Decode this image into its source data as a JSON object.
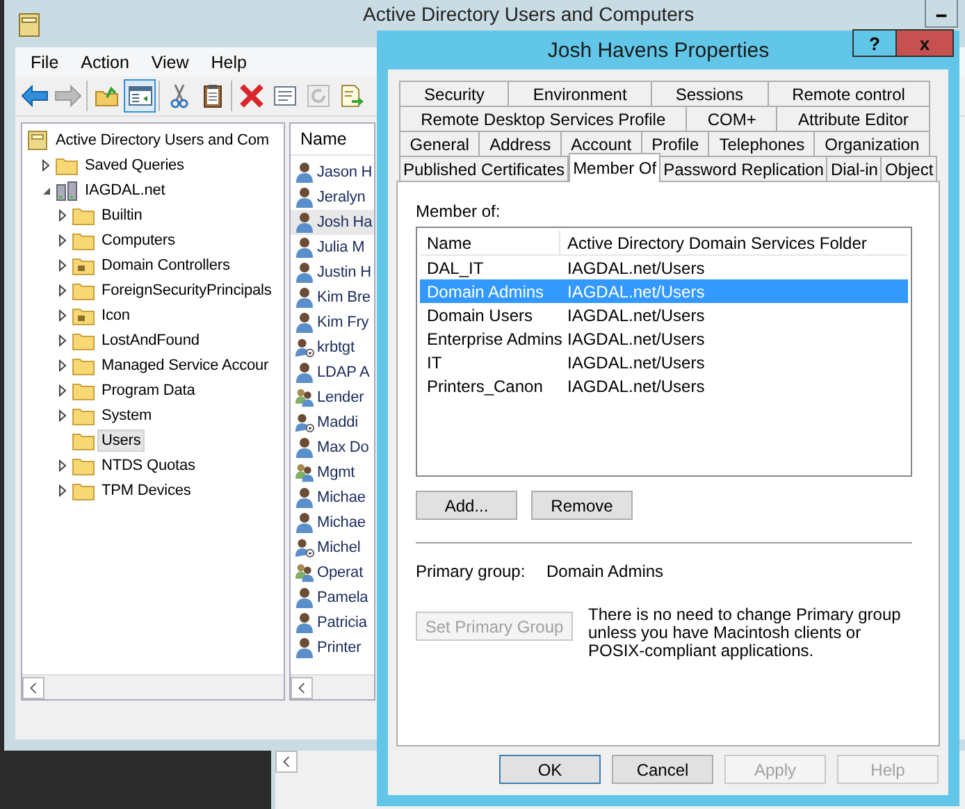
{
  "main_window": {
    "title": "Active Directory Users and Computers",
    "menu": [
      "File",
      "Action",
      "View",
      "Help"
    ],
    "toolbar": [
      {
        "kind": "back",
        "disabled": false,
        "selected": false
      },
      {
        "kind": "forward",
        "disabled": true,
        "selected": false
      },
      {
        "kind": "sep"
      },
      {
        "kind": "up",
        "disabled": false,
        "selected": false
      },
      {
        "kind": "tree",
        "disabled": false,
        "selected": true
      },
      {
        "kind": "sep"
      },
      {
        "kind": "cut",
        "disabled": false,
        "selected": false
      },
      {
        "kind": "paste",
        "disabled": false,
        "selected": false
      },
      {
        "kind": "sep"
      },
      {
        "kind": "delete",
        "disabled": false,
        "selected": false
      },
      {
        "kind": "properties",
        "disabled": false,
        "selected": false
      },
      {
        "kind": "refresh",
        "disabled": true,
        "selected": false
      },
      {
        "kind": "export",
        "disabled": false,
        "selected": false
      }
    ],
    "tree": {
      "label": "Active Directory Users and Com",
      "kind": "snapin",
      "children": [
        {
          "label": "Saved Queries",
          "kind": "folder",
          "expandable": true,
          "expanded": false,
          "selected": false
        },
        {
          "label": "IAGDAL.net",
          "kind": "domain",
          "expandable": true,
          "expanded": true,
          "selected": false,
          "children": [
            {
              "label": "Builtin",
              "kind": "folder",
              "expandable": true,
              "expanded": false,
              "selected": false
            },
            {
              "label": "Computers",
              "kind": "folder",
              "expandable": true,
              "expanded": false,
              "selected": false
            },
            {
              "label": "Domain Controllers",
              "kind": "ou",
              "expandable": true,
              "expanded": false,
              "selected": false
            },
            {
              "label": "ForeignSecurityPrincipals",
              "kind": "folder",
              "expandable": true,
              "expanded": false,
              "selected": false
            },
            {
              "label": "Icon",
              "kind": "ou",
              "expandable": true,
              "expanded": false,
              "selected": false
            },
            {
              "label": "LostAndFound",
              "kind": "folder",
              "expandable": true,
              "expanded": false,
              "selected": false
            },
            {
              "label": "Managed Service Accour",
              "kind": "folder",
              "expandable": true,
              "expanded": false,
              "selected": false
            },
            {
              "label": "Program Data",
              "kind": "folder",
              "expandable": true,
              "expanded": false,
              "selected": false
            },
            {
              "label": "System",
              "kind": "folder",
              "expandable": true,
              "expanded": false,
              "selected": false
            },
            {
              "label": "Users",
              "kind": "folder",
              "expandable": false,
              "selected": true
            },
            {
              "label": "NTDS Quotas",
              "kind": "folder",
              "expandable": true,
              "expanded": false,
              "selected": false
            },
            {
              "label": "TPM Devices",
              "kind": "folder",
              "expandable": true,
              "expanded": false,
              "selected": false
            }
          ]
        }
      ]
    },
    "list": {
      "column": "Name",
      "rows": [
        {
          "name": "Jason H",
          "kind": "user",
          "selected": false
        },
        {
          "name": "Jeralyn",
          "kind": "user",
          "selected": false
        },
        {
          "name": "Josh Ha",
          "kind": "user",
          "selected": true
        },
        {
          "name": "Julia M",
          "kind": "user",
          "selected": false
        },
        {
          "name": "Justin H",
          "kind": "user",
          "selected": false
        },
        {
          "name": "Kim Bre",
          "kind": "user",
          "selected": false
        },
        {
          "name": "Kim Fry",
          "kind": "user",
          "selected": false
        },
        {
          "name": "krbtgt",
          "kind": "disabled-user",
          "selected": false
        },
        {
          "name": "LDAP A",
          "kind": "user",
          "selected": false
        },
        {
          "name": "Lender",
          "kind": "group",
          "selected": false
        },
        {
          "name": "Maddi",
          "kind": "disabled-user",
          "selected": false
        },
        {
          "name": "Max Do",
          "kind": "user",
          "selected": false
        },
        {
          "name": "Mgmt",
          "kind": "group",
          "selected": false
        },
        {
          "name": "Michae",
          "kind": "user",
          "selected": false
        },
        {
          "name": "Michae",
          "kind": "user",
          "selected": false
        },
        {
          "name": "Michel",
          "kind": "disabled-user",
          "selected": false
        },
        {
          "name": "Operat",
          "kind": "group",
          "selected": false
        },
        {
          "name": "Pamela",
          "kind": "user",
          "selected": false
        },
        {
          "name": "Patricia",
          "kind": "user",
          "selected": false
        },
        {
          "name": "Printer",
          "kind": "user",
          "selected": false
        }
      ]
    }
  },
  "dialog": {
    "title": "Josh Havens Properties",
    "help_button": "?",
    "close_button": "x",
    "tab_rows": [
      [
        {
          "label": "Security",
          "selected": false
        },
        {
          "label": "Environment",
          "selected": false
        },
        {
          "label": "Sessions",
          "selected": false
        },
        {
          "label": "Remote control",
          "selected": false
        }
      ],
      [
        {
          "label": "Remote Desktop Services Profile",
          "selected": false
        },
        {
          "label": "COM+",
          "selected": false
        },
        {
          "label": "Attribute Editor",
          "selected": false
        }
      ],
      [
        {
          "label": "General",
          "selected": false
        },
        {
          "label": "Address",
          "selected": false
        },
        {
          "label": "Account",
          "selected": false
        },
        {
          "label": "Profile",
          "selected": false
        },
        {
          "label": "Telephones",
          "selected": false
        },
        {
          "label": "Organization",
          "selected": false
        }
      ],
      [
        {
          "label": "Published Certificates",
          "selected": false
        },
        {
          "label": "Member Of",
          "selected": true
        },
        {
          "label": "Password Replication",
          "selected": false
        },
        {
          "label": "Dial-in",
          "selected": false
        },
        {
          "label": "Object",
          "selected": false
        }
      ]
    ],
    "member_of_label": "Member of:",
    "table": {
      "columns": [
        "Name",
        "Active Directory Domain Services Folder"
      ],
      "rows": [
        {
          "name": "DAL_IT",
          "folder": "IAGDAL.net/Users",
          "selected": false
        },
        {
          "name": "Domain Admins",
          "folder": "IAGDAL.net/Users",
          "selected": true
        },
        {
          "name": "Domain Users",
          "folder": "IAGDAL.net/Users",
          "selected": false
        },
        {
          "name": "Enterprise Admins",
          "folder": "IAGDAL.net/Users",
          "selected": false
        },
        {
          "name": "IT",
          "folder": "IAGDAL.net/Users",
          "selected": false
        },
        {
          "name": "Printers_Canon",
          "folder": "IAGDAL.net/Users",
          "selected": false
        }
      ]
    },
    "list_buttons": [
      {
        "label": "Add...",
        "disabled": false
      },
      {
        "label": "Remove",
        "disabled": false
      }
    ],
    "primary_group_label": "Primary group:",
    "primary_group": "Domain Admins",
    "set_primary_button": {
      "label": "Set Primary Group",
      "disabled": true
    },
    "note": "There is no need to change Primary group unless you have Macintosh clients or POSIX-compliant applications.",
    "buttons": [
      {
        "label": "OK",
        "disabled": false,
        "default": true
      },
      {
        "label": "Cancel",
        "disabled": false,
        "default": false
      },
      {
        "label": "Apply",
        "disabled": true,
        "default": false
      },
      {
        "label": "Help",
        "disabled": true,
        "default": false
      }
    ]
  }
}
